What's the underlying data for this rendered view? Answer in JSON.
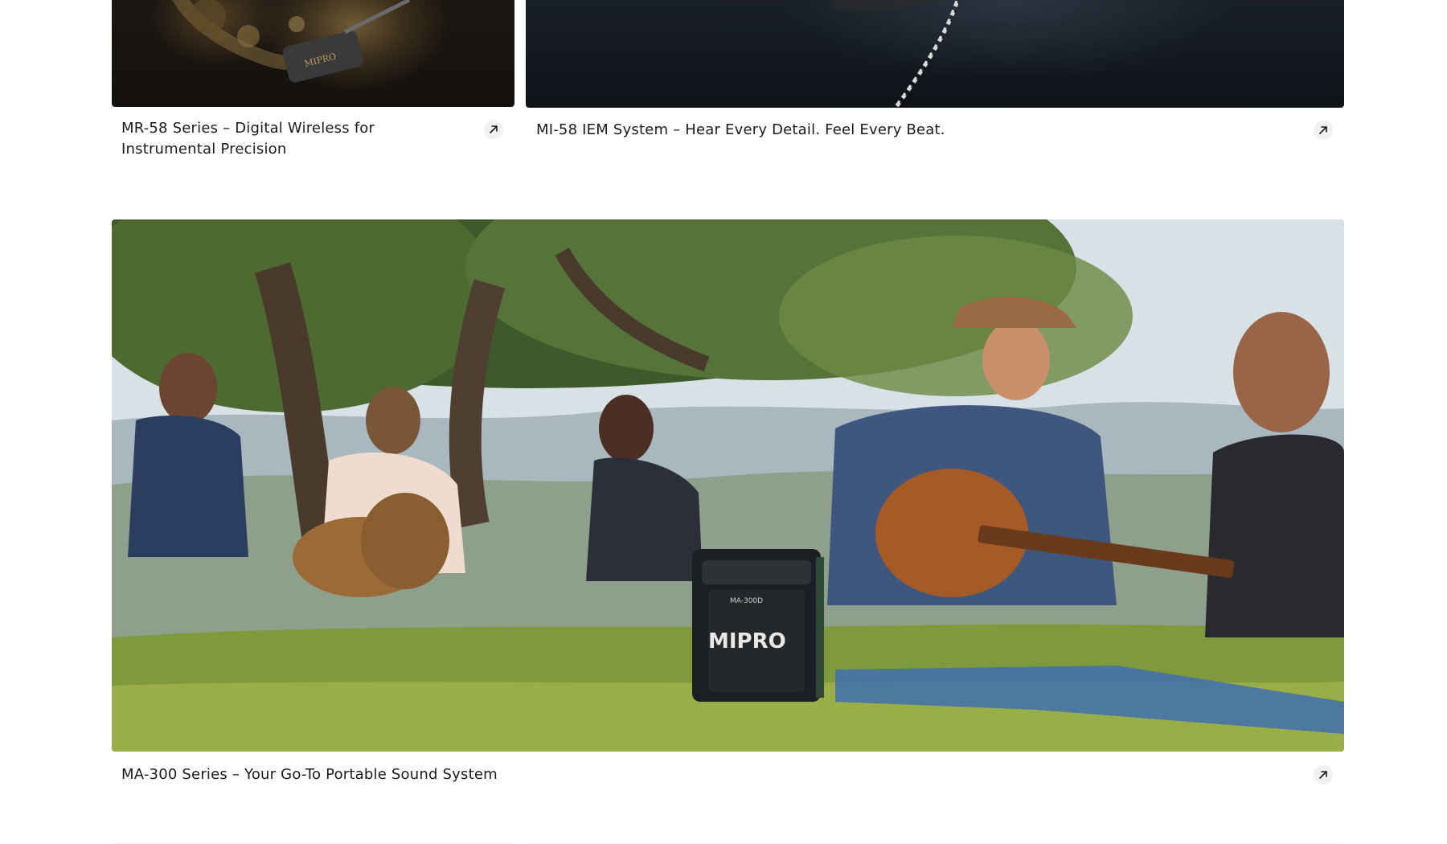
{
  "cards": [
    {
      "title": "MR-58 Series – Digital Wireless for Instrumental Precision",
      "title_line1": "MR-58 Series – Digital Wireless for",
      "title_line2": "Instrumental Precision",
      "image_alt": "Saxophone with MIPRO clip-on wireless transmitter",
      "image_text": "MIPRO",
      "link_icon": "arrow-up-right-icon"
    },
    {
      "title": "MI-58 IEM System – Hear Every Detail. Feel Every Beat.",
      "image_alt": "In-ear monitor cable on dark fabric",
      "link_icon": "arrow-up-right-icon"
    },
    {
      "title": "MA-300 Series – Your Go-To Portable Sound System",
      "image_alt": "Friends having a picnic with a MIPRO MA-300D portable speaker",
      "image_text_logo": "MIPRO",
      "image_text_model": "MA-300D",
      "link_icon": "arrow-up-right-icon"
    }
  ],
  "colors": {
    "text": "#1b1b1b",
    "icon_bg": "#f1f1f1",
    "page_bg": "#ffffff"
  }
}
